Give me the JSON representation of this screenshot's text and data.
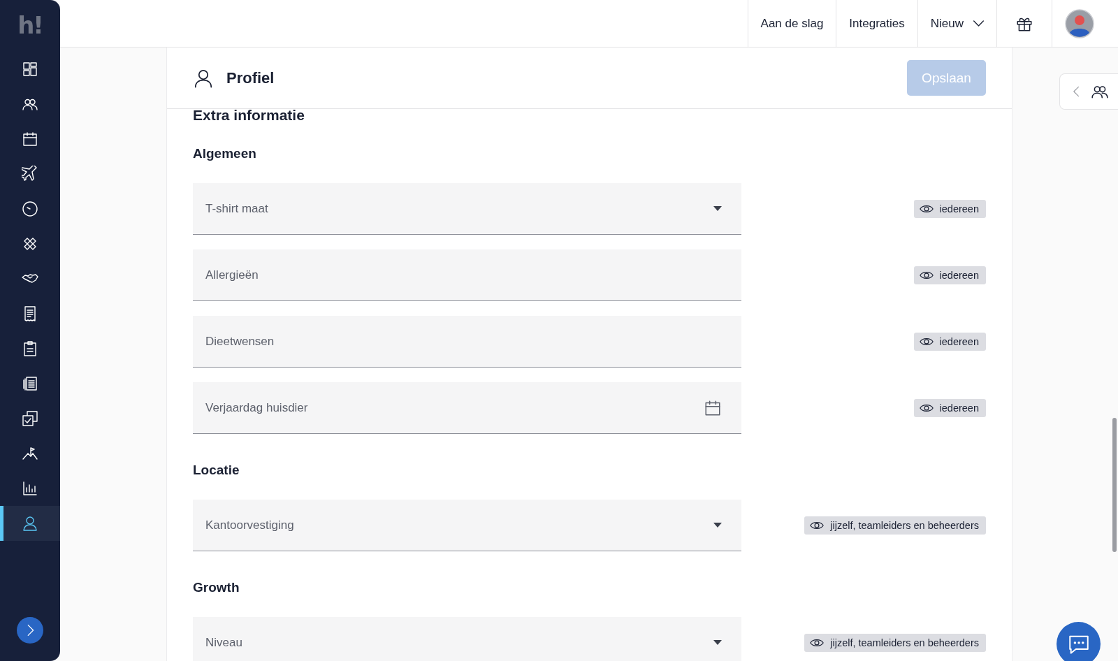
{
  "sidebar": {
    "logo": "h!",
    "items": [
      {
        "kind": "dashboard",
        "selected": false
      },
      {
        "kind": "people",
        "selected": false
      },
      {
        "kind": "calendar",
        "selected": false
      },
      {
        "kind": "plane",
        "selected": false
      },
      {
        "kind": "clock",
        "selected": false
      },
      {
        "kind": "bandage",
        "selected": false
      },
      {
        "kind": "handshake",
        "selected": false
      },
      {
        "kind": "receipt",
        "selected": false
      },
      {
        "kind": "clipboard",
        "selected": false
      },
      {
        "kind": "documents",
        "selected": false
      },
      {
        "kind": "checkbox",
        "selected": false
      },
      {
        "kind": "flag",
        "selected": false
      },
      {
        "kind": "barchart",
        "selected": false
      },
      {
        "kind": "person",
        "selected": true
      }
    ]
  },
  "topbar": {
    "links": [
      {
        "label": "Aan de slag",
        "dropdown": false
      },
      {
        "label": "Integraties",
        "dropdown": false
      },
      {
        "label": "Nieuw",
        "dropdown": true
      }
    ]
  },
  "team_panel": {
    "expanded": false
  },
  "panel": {
    "title": "Profiel",
    "save_button": {
      "label": "Opslaan",
      "disabled": true
    },
    "heading": "Extra informatie",
    "sections": [
      {
        "title": "Algemeen",
        "fields": [
          {
            "kind": "select",
            "placeholder": "T-shirt maat",
            "visibility": "iedereen"
          },
          {
            "kind": "text",
            "placeholder": "Allergieën",
            "visibility": "iedereen"
          },
          {
            "kind": "text",
            "placeholder": "Dieetwensen",
            "visibility": "iedereen"
          },
          {
            "kind": "date",
            "placeholder": "Verjaardag huisdier",
            "visibility": "iedereen"
          }
        ]
      },
      {
        "title": "Locatie",
        "fields": [
          {
            "kind": "select",
            "placeholder": "Kantoorvestiging",
            "visibility": "jijzelf, teamleiders en beheerders"
          }
        ]
      },
      {
        "title": "Growth",
        "fields": [
          {
            "kind": "select",
            "placeholder": "Niveau",
            "visibility": "jijzelf, teamleiders en beheerders"
          }
        ]
      }
    ]
  }
}
